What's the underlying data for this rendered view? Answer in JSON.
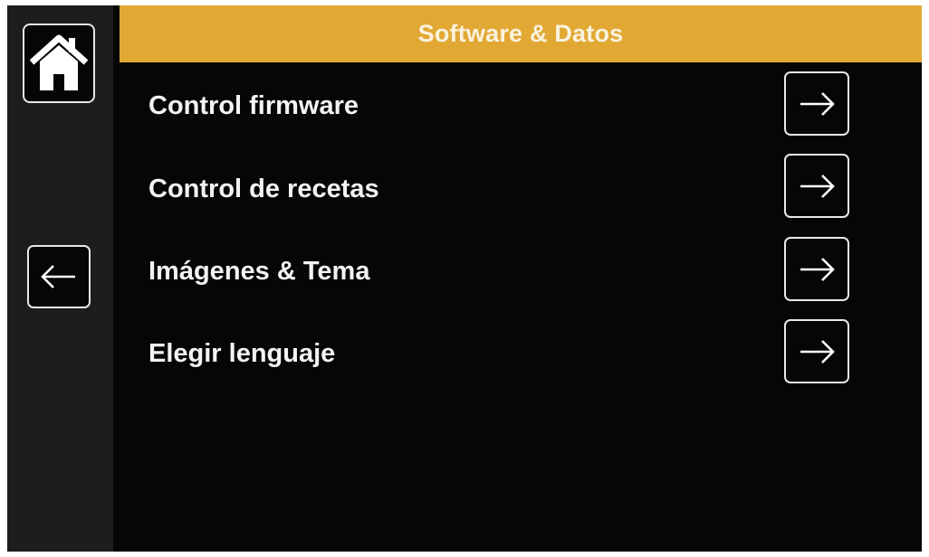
{
  "header": {
    "title": "Software & Datos"
  },
  "sidebar": {
    "home_icon": "home-icon",
    "back_icon": "arrow-left-icon"
  },
  "menu": {
    "items": [
      {
        "label": "Control firmware",
        "icon": "arrow-right-icon"
      },
      {
        "label": "Control de recetas",
        "icon": "arrow-right-icon"
      },
      {
        "label": "Imágenes & Tema",
        "icon": "arrow-right-icon"
      },
      {
        "label": "Elegir lenguaje",
        "icon": "arrow-right-icon"
      }
    ]
  },
  "colors": {
    "header_accent": "#e1a834",
    "background": "#060606",
    "sidebar": "#1b1e1d",
    "text": "#f3f3f3"
  }
}
